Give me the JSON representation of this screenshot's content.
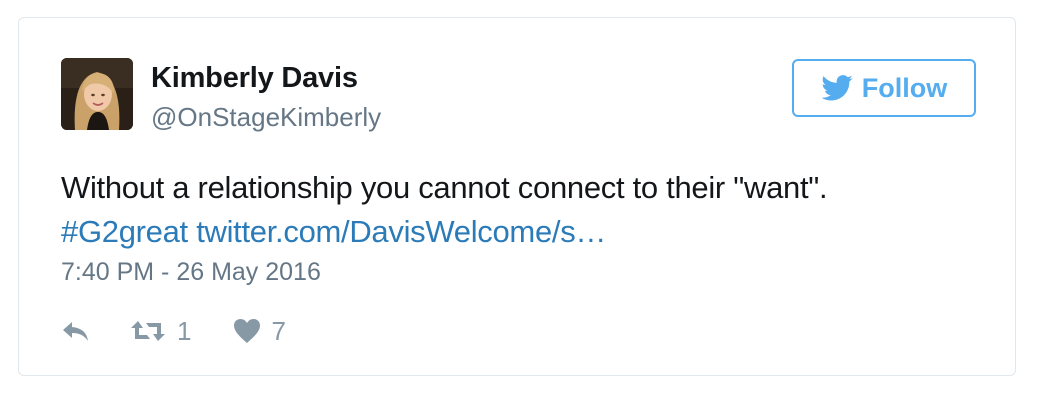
{
  "author": {
    "name": "Kimberly Davis",
    "handle": "@OnStageKimberly"
  },
  "follow_button": {
    "label": "Follow",
    "icon": "twitter-bird-icon",
    "color": "#55acee"
  },
  "tweet": {
    "text": "Without a relationship you cannot connect to their \"want\".",
    "hashtag": "#G2great",
    "link": "twitter.com/DavisWelcome/s…",
    "link_color": "#2b7bb9"
  },
  "timestamp": "7:40 PM - 26 May 2016",
  "actions": {
    "reply_icon": "reply-icon",
    "retweet_icon": "retweet-icon",
    "retweet_count": "1",
    "like_icon": "heart-icon",
    "like_count": "7"
  }
}
